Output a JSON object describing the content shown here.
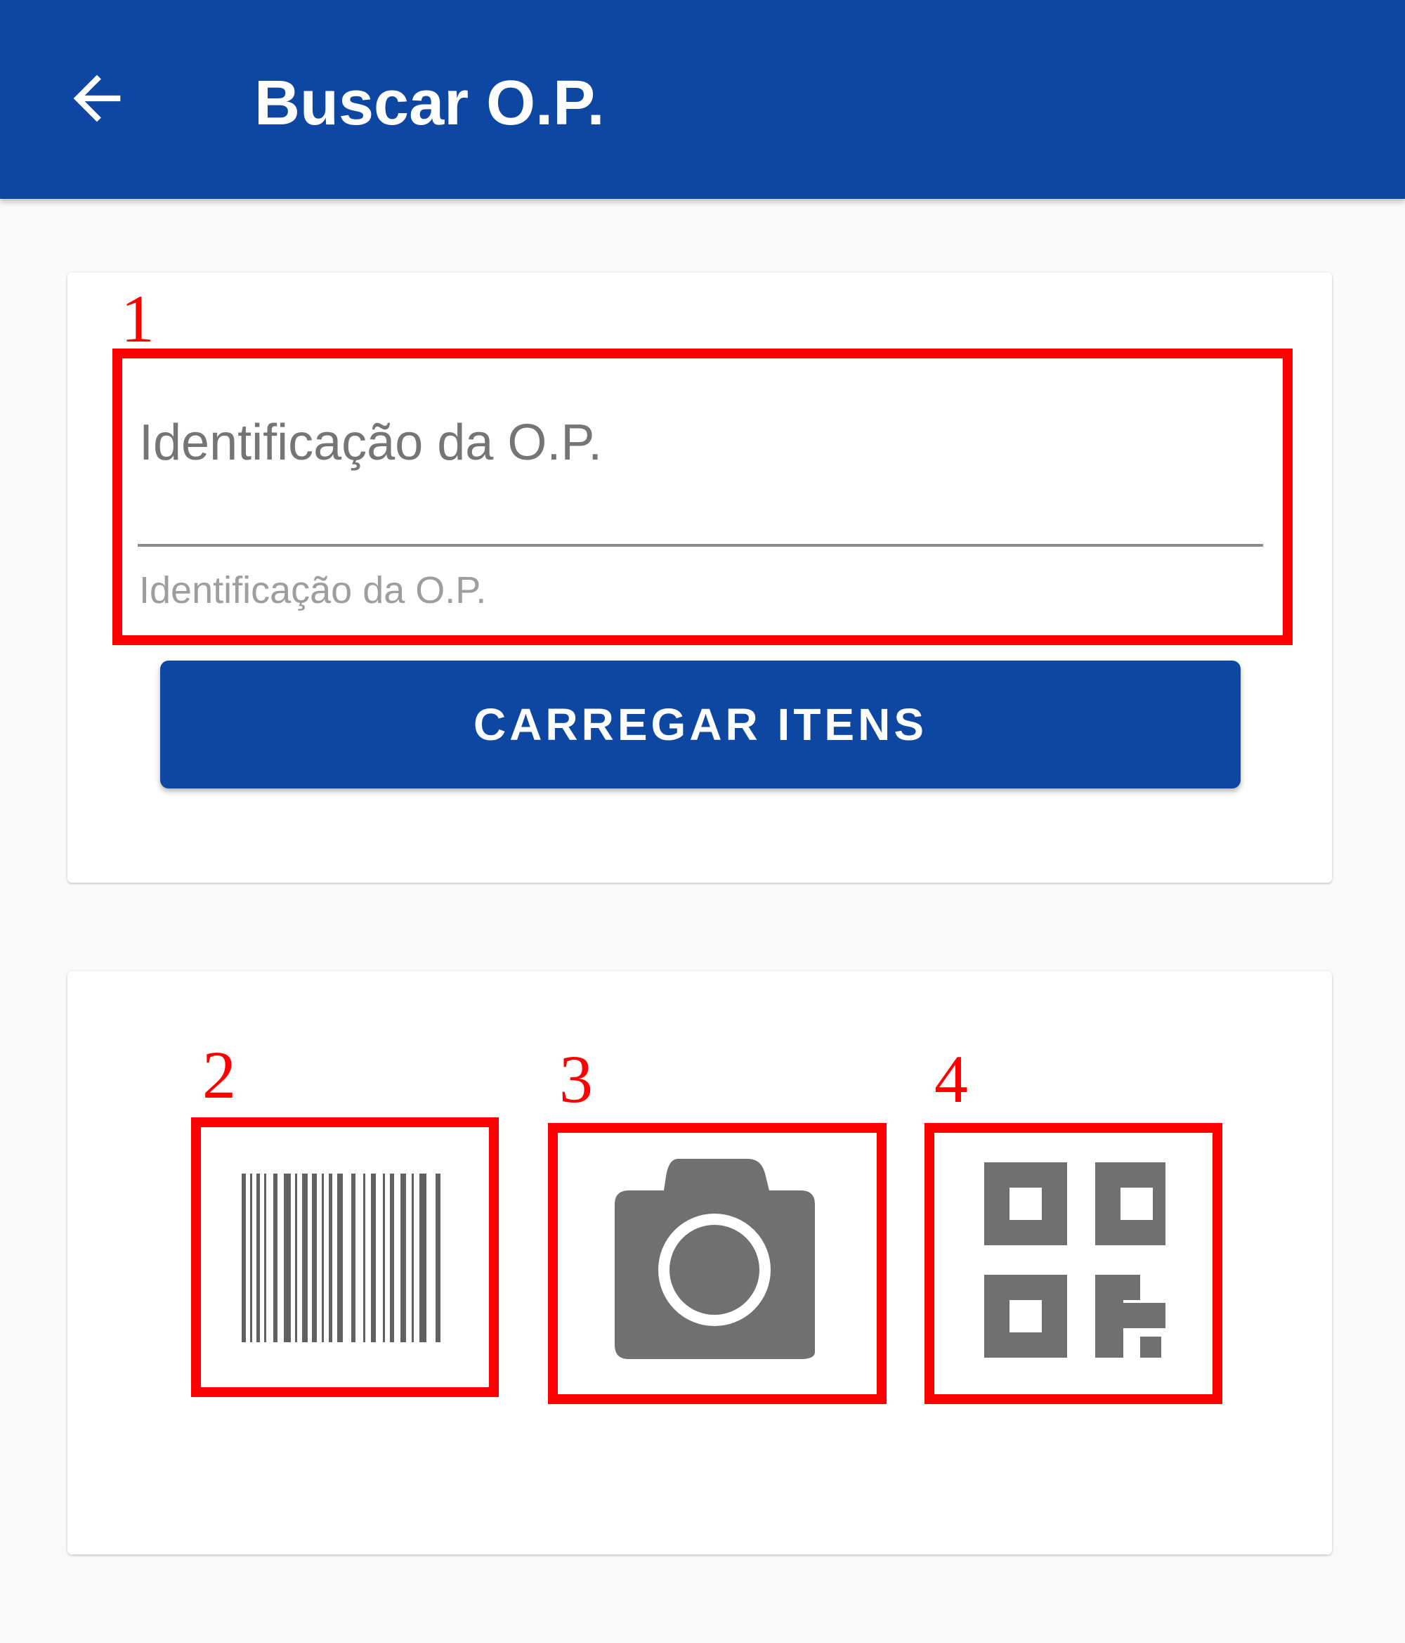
{
  "appbar": {
    "title": "Buscar O.P.",
    "back_icon": "arrow-back-icon",
    "color": "#0d47a1"
  },
  "search": {
    "label": "Identificação da O.P.",
    "value": "",
    "helper": "Identificação da O.P.",
    "button_label": "CARREGAR ITENS"
  },
  "scanners": [
    {
      "icon": "barcode-icon"
    },
    {
      "icon": "camera-icon"
    },
    {
      "icon": "qr-code-icon"
    }
  ],
  "annotations": {
    "markers": [
      "1",
      "2",
      "3",
      "4"
    ],
    "color": "#ff0000"
  }
}
